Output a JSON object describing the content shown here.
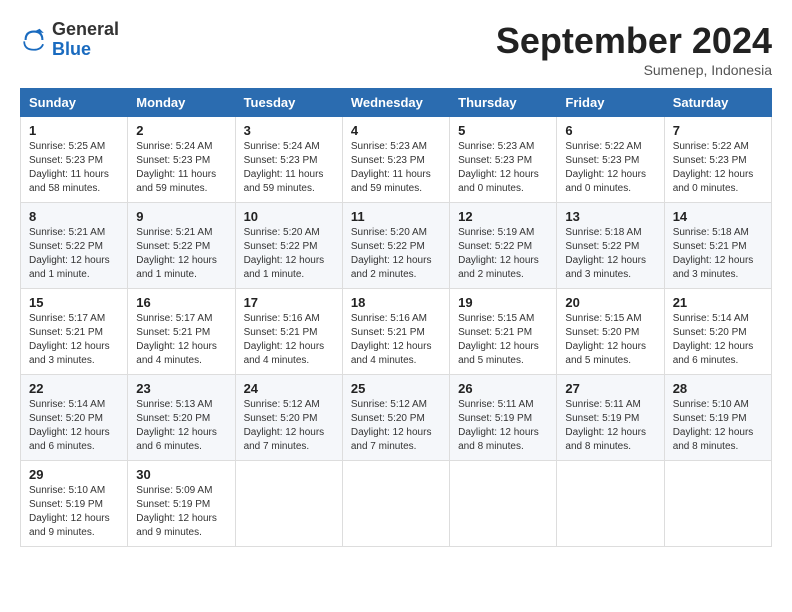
{
  "header": {
    "logo_general": "General",
    "logo_blue": "Blue",
    "month_title": "September 2024",
    "subtitle": "Sumenep, Indonesia"
  },
  "days_of_week": [
    "Sunday",
    "Monday",
    "Tuesday",
    "Wednesday",
    "Thursday",
    "Friday",
    "Saturday"
  ],
  "weeks": [
    [
      {
        "day": "1",
        "sunrise": "5:25 AM",
        "sunset": "5:23 PM",
        "daylight": "11 hours and 58 minutes."
      },
      {
        "day": "2",
        "sunrise": "5:24 AM",
        "sunset": "5:23 PM",
        "daylight": "11 hours and 59 minutes."
      },
      {
        "day": "3",
        "sunrise": "5:24 AM",
        "sunset": "5:23 PM",
        "daylight": "11 hours and 59 minutes."
      },
      {
        "day": "4",
        "sunrise": "5:23 AM",
        "sunset": "5:23 PM",
        "daylight": "11 hours and 59 minutes."
      },
      {
        "day": "5",
        "sunrise": "5:23 AM",
        "sunset": "5:23 PM",
        "daylight": "12 hours and 0 minutes."
      },
      {
        "day": "6",
        "sunrise": "5:22 AM",
        "sunset": "5:23 PM",
        "daylight": "12 hours and 0 minutes."
      },
      {
        "day": "7",
        "sunrise": "5:22 AM",
        "sunset": "5:23 PM",
        "daylight": "12 hours and 0 minutes."
      }
    ],
    [
      {
        "day": "8",
        "sunrise": "5:21 AM",
        "sunset": "5:22 PM",
        "daylight": "12 hours and 1 minute."
      },
      {
        "day": "9",
        "sunrise": "5:21 AM",
        "sunset": "5:22 PM",
        "daylight": "12 hours and 1 minute."
      },
      {
        "day": "10",
        "sunrise": "5:20 AM",
        "sunset": "5:22 PM",
        "daylight": "12 hours and 1 minute."
      },
      {
        "day": "11",
        "sunrise": "5:20 AM",
        "sunset": "5:22 PM",
        "daylight": "12 hours and 2 minutes."
      },
      {
        "day": "12",
        "sunrise": "5:19 AM",
        "sunset": "5:22 PM",
        "daylight": "12 hours and 2 minutes."
      },
      {
        "day": "13",
        "sunrise": "5:18 AM",
        "sunset": "5:22 PM",
        "daylight": "12 hours and 3 minutes."
      },
      {
        "day": "14",
        "sunrise": "5:18 AM",
        "sunset": "5:21 PM",
        "daylight": "12 hours and 3 minutes."
      }
    ],
    [
      {
        "day": "15",
        "sunrise": "5:17 AM",
        "sunset": "5:21 PM",
        "daylight": "12 hours and 3 minutes."
      },
      {
        "day": "16",
        "sunrise": "5:17 AM",
        "sunset": "5:21 PM",
        "daylight": "12 hours and 4 minutes."
      },
      {
        "day": "17",
        "sunrise": "5:16 AM",
        "sunset": "5:21 PM",
        "daylight": "12 hours and 4 minutes."
      },
      {
        "day": "18",
        "sunrise": "5:16 AM",
        "sunset": "5:21 PM",
        "daylight": "12 hours and 4 minutes."
      },
      {
        "day": "19",
        "sunrise": "5:15 AM",
        "sunset": "5:21 PM",
        "daylight": "12 hours and 5 minutes."
      },
      {
        "day": "20",
        "sunrise": "5:15 AM",
        "sunset": "5:20 PM",
        "daylight": "12 hours and 5 minutes."
      },
      {
        "day": "21",
        "sunrise": "5:14 AM",
        "sunset": "5:20 PM",
        "daylight": "12 hours and 6 minutes."
      }
    ],
    [
      {
        "day": "22",
        "sunrise": "5:14 AM",
        "sunset": "5:20 PM",
        "daylight": "12 hours and 6 minutes."
      },
      {
        "day": "23",
        "sunrise": "5:13 AM",
        "sunset": "5:20 PM",
        "daylight": "12 hours and 6 minutes."
      },
      {
        "day": "24",
        "sunrise": "5:12 AM",
        "sunset": "5:20 PM",
        "daylight": "12 hours and 7 minutes."
      },
      {
        "day": "25",
        "sunrise": "5:12 AM",
        "sunset": "5:20 PM",
        "daylight": "12 hours and 7 minutes."
      },
      {
        "day": "26",
        "sunrise": "5:11 AM",
        "sunset": "5:19 PM",
        "daylight": "12 hours and 8 minutes."
      },
      {
        "day": "27",
        "sunrise": "5:11 AM",
        "sunset": "5:19 PM",
        "daylight": "12 hours and 8 minutes."
      },
      {
        "day": "28",
        "sunrise": "5:10 AM",
        "sunset": "5:19 PM",
        "daylight": "12 hours and 8 minutes."
      }
    ],
    [
      {
        "day": "29",
        "sunrise": "5:10 AM",
        "sunset": "5:19 PM",
        "daylight": "12 hours and 9 minutes."
      },
      {
        "day": "30",
        "sunrise": "5:09 AM",
        "sunset": "5:19 PM",
        "daylight": "12 hours and 9 minutes."
      },
      null,
      null,
      null,
      null,
      null
    ]
  ],
  "labels": {
    "sunrise": "Sunrise:",
    "sunset": "Sunset:",
    "daylight": "Daylight:"
  }
}
